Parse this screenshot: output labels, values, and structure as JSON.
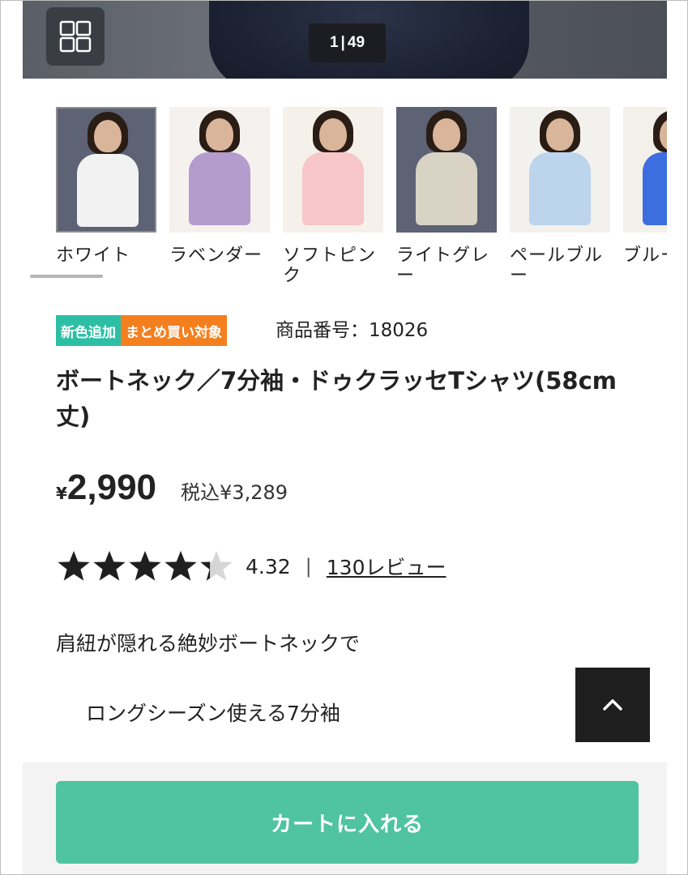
{
  "gallery": {
    "current": "1",
    "separator": "|",
    "total": "49",
    "grid_icon": "grid-view-icon"
  },
  "colors": [
    {
      "label": "ホワイト",
      "swatch": "#f2f2f2",
      "bg": "#5d6275"
    },
    {
      "label": "ラベンダー",
      "swatch": "#b49ccc",
      "bg": "#f4f1ee"
    },
    {
      "label": "ソフトピンク",
      "swatch": "#f6c6c8",
      "bg": "#f6f0ea"
    },
    {
      "label": "ライトグレー",
      "swatch": "#d9d3c6",
      "bg": "#5d6275"
    },
    {
      "label": "ペールブルー",
      "swatch": "#bcd4ec",
      "bg": "#f3f1ee"
    },
    {
      "label": "ブルー",
      "swatch": "#3d6ee0",
      "bg": "#f3efe9"
    }
  ],
  "badges": {
    "new_color": "新色追加",
    "bulk_buy": "まとめ買い対象"
  },
  "product": {
    "sku": "商品番号：18026",
    "title": "ボートネック／7分袖・ドゥクラッセTシャツ(58cm丈)",
    "price_symbol": "¥",
    "price": "2,990",
    "price_taxed": "税込¥3,289",
    "rating": 4.32,
    "rating_text": "4.32",
    "rating_divider": "|",
    "reviews": "130レビュー",
    "desc_line1": "肩紐が隠れる絶妙ボートネックで",
    "desc_line2": "ロングシーズン使える7分袖"
  },
  "actions": {
    "cart": "カートに入れる",
    "back_to_top_icon": "chevron-up-icon"
  },
  "theme": {
    "accent": "#4fc49e",
    "badge_new": "#2dbfa5",
    "badge_bulk": "#f47f1f"
  }
}
